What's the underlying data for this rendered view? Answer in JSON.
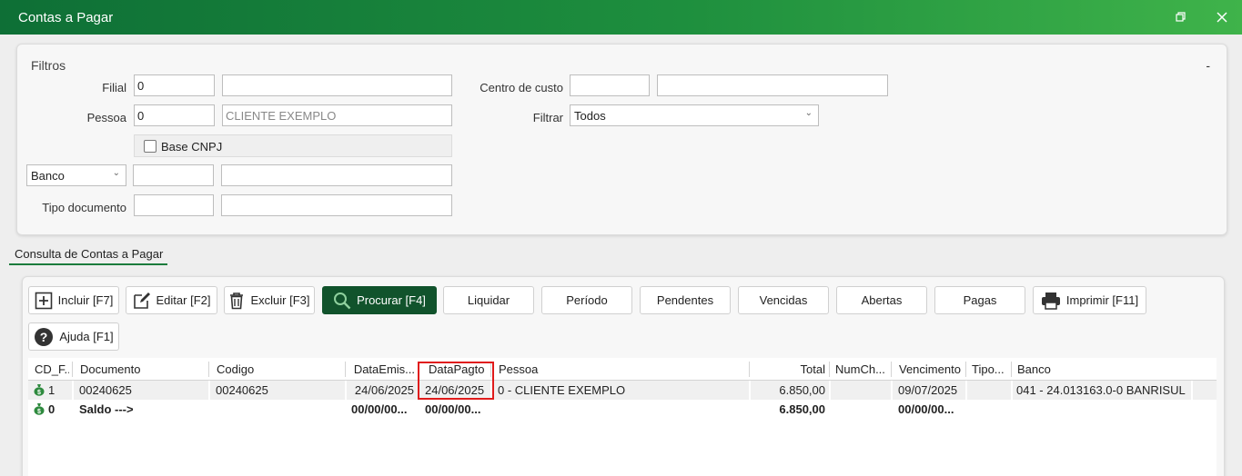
{
  "window": {
    "title": "Contas a Pagar",
    "restore_icon": "restore-icon",
    "close_icon": "close-icon"
  },
  "filters": {
    "legend": "Filtros",
    "collapse_label": "-",
    "filial": {
      "label": "Filial",
      "code": "0",
      "name": ""
    },
    "pessoa": {
      "label": "Pessoa",
      "code": "0",
      "name": "CLIENTE EXEMPLO"
    },
    "base_cnpj": {
      "label": "Base CNPJ",
      "checked": false
    },
    "banco": {
      "selected": "Banco",
      "code": "",
      "name": ""
    },
    "tipo_documento": {
      "label": "Tipo documento",
      "code": "",
      "name": ""
    },
    "centro_custo": {
      "label": "Centro de custo",
      "code": "",
      "name": ""
    },
    "filtrar": {
      "label": "Filtrar",
      "selected": "Todos"
    }
  },
  "tab": {
    "label": "Consulta de Contas a Pagar"
  },
  "toolbar": {
    "incluir": "Incluir [F7]",
    "editar": "Editar [F2]",
    "excluir": "Excluir [F3]",
    "procurar": "Procurar [F4]",
    "liquidar": "Liquidar",
    "periodo": "Período",
    "pendentes": "Pendentes",
    "vencidas": "Vencidas",
    "abertas": "Abertas",
    "pagas": "Pagas",
    "imprimir": "Imprimir [F11]",
    "ajuda": "Ajuda [F1]",
    "primary_color": "#11532c"
  },
  "grid": {
    "columns": [
      "CD_F...",
      "Documento",
      "Codigo",
      "DataEmis...",
      "DataPagto",
      "Pessoa",
      "Total",
      "NumCh...",
      "Vencimento",
      "Tipo...",
      "Banco"
    ],
    "rows": [
      {
        "cd_f": "1",
        "documento": "00240625",
        "codigo": "00240625",
        "data_emissao": "24/06/2025",
        "data_pagto": "24/06/2025",
        "pessoa": "0 - CLIENTE EXEMPLO",
        "total": "6.850,00",
        "num_cheque": "",
        "vencimento": "09/07/2025",
        "tipo": "",
        "banco": "041 - 24.013163.0-0 BANRISUL"
      }
    ],
    "summary": {
      "cd_f": "0",
      "documento": "Saldo --->",
      "data_emissao": "00/00/00...",
      "data_pagto": "00/00/00...",
      "total": "6.850,00",
      "vencimento": "00/00/00..."
    },
    "highlight_color": "#e01b1b"
  }
}
